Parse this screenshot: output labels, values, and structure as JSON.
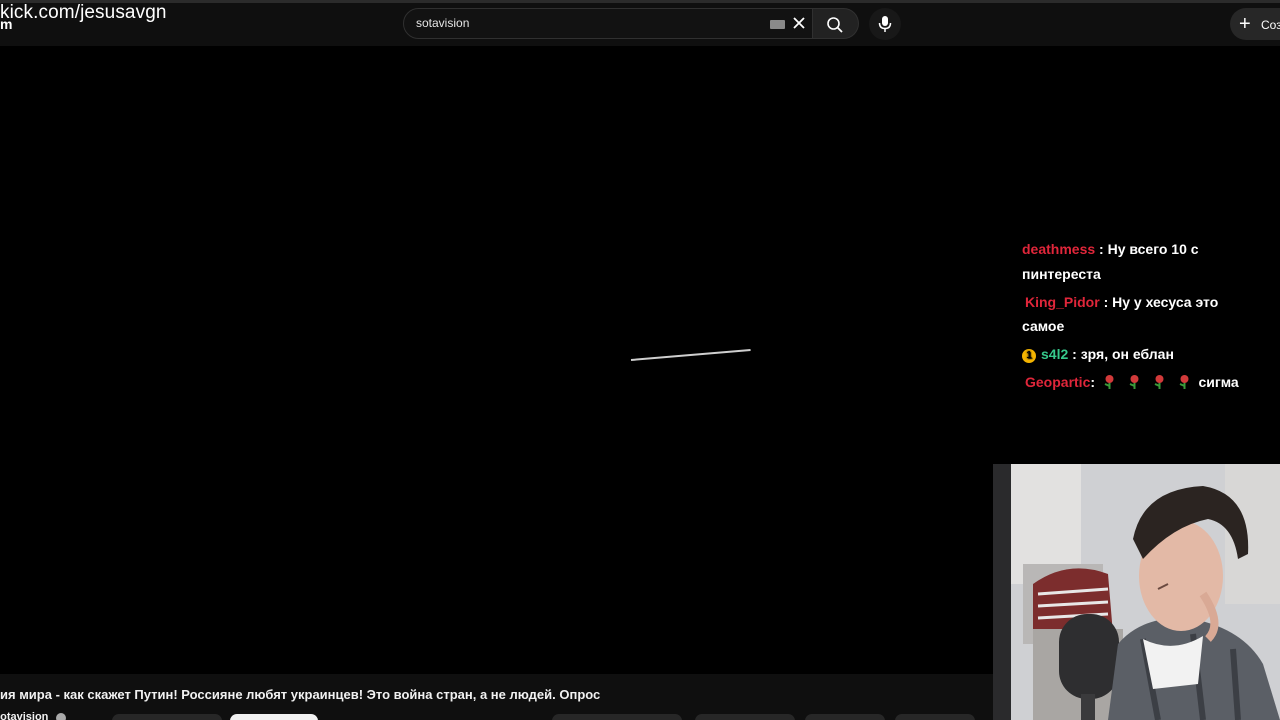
{
  "overlay": {
    "url_line1": "kick.com/jesusavgn",
    "url_line2": "m"
  },
  "search": {
    "query": "sotavision"
  },
  "header": {
    "create_label": "Создать"
  },
  "chat": {
    "messages": [
      {
        "user": "deathmess",
        "text": ": Ну всего 10 с"
      },
      {
        "user": "",
        "text": "пинтереста"
      },
      {
        "user": "King_Pidor",
        "text": ": Ну у хесуса это"
      },
      {
        "user": "",
        "text": "самое"
      },
      {
        "user": "s4l2",
        "text": ": зря, он еблан",
        "badge": "1"
      },
      {
        "user": "Geopartic",
        "text": ":",
        "text2": "сигма"
      }
    ]
  },
  "video": {
    "title": "ия мира - как скажет Путин! Россияне любят украинцев! Это война стран, а не людей. Опрос",
    "channel": "sotavision"
  },
  "colors": {
    "chat_name": "#e0263a",
    "chat_name_green": "#36c98b",
    "badge": "#f4b400"
  }
}
